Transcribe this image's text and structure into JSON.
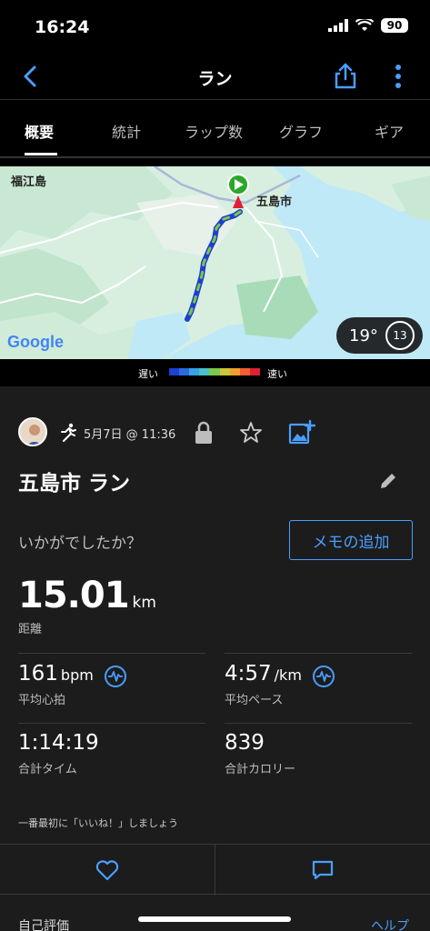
{
  "status": {
    "time": "16:24",
    "battery": "90"
  },
  "nav": {
    "title": "ラン"
  },
  "tabs": [
    {
      "label": "概要"
    },
    {
      "label": "統計"
    },
    {
      "label": "ラップ数"
    },
    {
      "label": "グラフ"
    },
    {
      "label": "ギア"
    }
  ],
  "map": {
    "label_island": "福江島",
    "label_city": "五島市",
    "google": "Google",
    "temperature": "19°",
    "wind": "13"
  },
  "legend": {
    "slow": "遅い",
    "fast": "速い",
    "colors": [
      "#1e3fd0",
      "#2a6be0",
      "#3aa0e8",
      "#4ac0c8",
      "#7cc84a",
      "#c8c83a",
      "#f0a030",
      "#f06030",
      "#e02030"
    ]
  },
  "activity": {
    "date": "5月7日 @ 11:36",
    "title": "五島市 ラン",
    "question": "いかがでしたか？",
    "memo_button": "メモの追加"
  },
  "stats": {
    "distance": {
      "value": "15.01",
      "unit": "km",
      "label": "距離"
    },
    "heart_rate": {
      "value": "161",
      "unit": "bpm",
      "label": "平均心拍"
    },
    "pace": {
      "value": "4:57",
      "unit": "/km",
      "label": "平均ペース"
    },
    "time": {
      "value": "1:14:19",
      "label": "合計タイム"
    },
    "calories": {
      "value": "839",
      "label": "合計カロリー"
    }
  },
  "social": {
    "like_prompt": "一番最初に「いいね！」しましょう"
  },
  "footer": {
    "left": "自己評価",
    "right": "ヘルプ"
  },
  "colors": {
    "accent": "#4a9eff",
    "background": "#1c1c1c"
  }
}
